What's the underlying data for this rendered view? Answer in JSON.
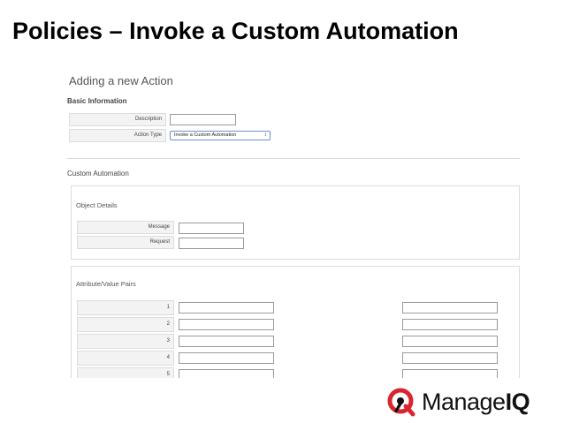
{
  "slide": {
    "title": "Policies – Invoke a Custom Automation"
  },
  "form": {
    "heading": "Adding a new Action",
    "basic_info": {
      "label": "Basic Information",
      "description_label": "Description",
      "description_value": "",
      "action_type_label": "Action Type",
      "action_type_value": "Invoke a Custom Automation"
    },
    "custom_automation": {
      "label": "Custom Automation",
      "object_details": {
        "label": "Object Details",
        "message_label": "Message",
        "message_value": "",
        "request_label": "Request",
        "request_value": ""
      },
      "attribute_value_pairs": {
        "label": "Attribute/Value Pairs",
        "rows": [
          "1",
          "2",
          "3",
          "4",
          "5"
        ]
      }
    }
  },
  "logo": {
    "text_manage": "Manage",
    "text_iq": "IQ",
    "accent_color": "#d9262e"
  }
}
